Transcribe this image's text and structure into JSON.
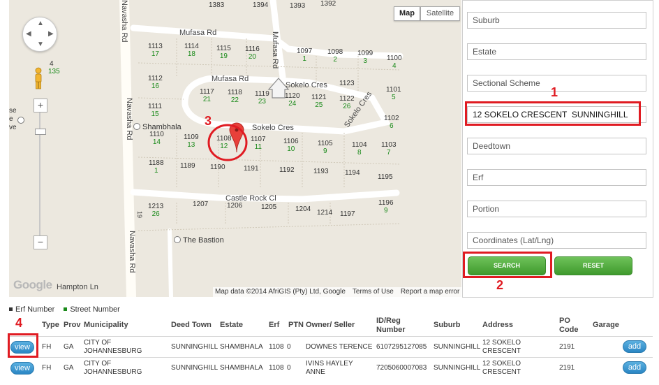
{
  "map": {
    "type_buttons": {
      "map": "Map",
      "satellite": "Satellite"
    },
    "side_numbers": {
      "top": "4",
      "bottom": "135"
    },
    "side_poi": [
      "se",
      "e",
      "ve"
    ],
    "road_labels": {
      "mufasa_top": "Mufasa Rd",
      "mufasa_mid": "Mufasa Rd",
      "mufasa_vertical": "Mufasa Rd",
      "sokelo_cres_top": "Sokelo Cres",
      "sokelo_cres_mid": "Sokelo Cres",
      "sokelo_cres_right": "Sokelo Cres",
      "castle_rock": "Castle Rock Cl",
      "navasha_top": "Navasha Rd",
      "navasha_mid": "Navasha Rd",
      "navasha_bottom": "Navasha Rd",
      "hampton": "Hampton Ln",
      "num_19": "19"
    },
    "poi": {
      "shambhala": "Shambhala",
      "the_bastion": "The Bastion"
    },
    "plots": [
      {
        "erf": "1383",
        "street": ""
      },
      {
        "erf": "1394",
        "street": ""
      },
      {
        "erf": "1393",
        "street": ""
      },
      {
        "erf": "1392",
        "street": ""
      },
      {
        "erf": "1113",
        "street": "17"
      },
      {
        "erf": "1114",
        "street": "18"
      },
      {
        "erf": "1115",
        "street": "19"
      },
      {
        "erf": "1116",
        "street": "20"
      },
      {
        "erf": "1097",
        "street": "1"
      },
      {
        "erf": "1098",
        "street": "2"
      },
      {
        "erf": "1099",
        "street": "3"
      },
      {
        "erf": "1100",
        "street": "4"
      },
      {
        "erf": "1112",
        "street": "16"
      },
      {
        "erf": "1117",
        "street": "21"
      },
      {
        "erf": "1118",
        "street": "22"
      },
      {
        "erf": "1119",
        "street": "23"
      },
      {
        "erf": "1120",
        "street": "24"
      },
      {
        "erf": "1121",
        "street": "25"
      },
      {
        "erf": "1122",
        "street": "26"
      },
      {
        "erf": "1123",
        "street": ""
      },
      {
        "erf": "1101",
        "street": "5"
      },
      {
        "erf": "1111",
        "street": "15"
      },
      {
        "erf": "1102",
        "street": "6"
      },
      {
        "erf": "1110",
        "street": "14"
      },
      {
        "erf": "1109",
        "street": "13"
      },
      {
        "erf": "1108",
        "street": "12"
      },
      {
        "erf": "1107",
        "street": "11"
      },
      {
        "erf": "1106",
        "street": "10"
      },
      {
        "erf": "1105",
        "street": "9"
      },
      {
        "erf": "1104",
        "street": "8"
      },
      {
        "erf": "1103",
        "street": "7"
      },
      {
        "erf": "1188",
        "street": "1"
      },
      {
        "erf": "1189",
        "street": ""
      },
      {
        "erf": "1190",
        "street": ""
      },
      {
        "erf": "1191",
        "street": ""
      },
      {
        "erf": "1192",
        "street": ""
      },
      {
        "erf": "1193",
        "street": ""
      },
      {
        "erf": "1194",
        "street": ""
      },
      {
        "erf": "1195",
        "street": ""
      },
      {
        "erf": "1213",
        "street": "26"
      },
      {
        "erf": "1207",
        "street": ""
      },
      {
        "erf": "1206",
        "street": ""
      },
      {
        "erf": "1205",
        "street": ""
      },
      {
        "erf": "1204",
        "street": ""
      },
      {
        "erf": "1214",
        "street": ""
      },
      {
        "erf": "1197",
        "street": ""
      },
      {
        "erf": "1196",
        "street": "9"
      }
    ],
    "attribution": {
      "data": "Map data ©2014 AfriGIS (Pty) Ltd, Google",
      "terms": "Terms of Use",
      "report": "Report a map error"
    },
    "google_logo": "Google",
    "colors": {
      "marker": "#e8403a",
      "street_number": "#1a8a1a",
      "background": "#ece8df"
    }
  },
  "search": {
    "suburb": {
      "placeholder": "Suburb",
      "value": ""
    },
    "estate": {
      "placeholder": "Estate",
      "value": ""
    },
    "sectional_scheme": {
      "placeholder": "Sectional Scheme",
      "value": ""
    },
    "address": {
      "placeholder": "",
      "value": "12 SOKELO CRESCENT  SUNNINGHILL"
    },
    "deedtown": {
      "placeholder": "Deedtown",
      "value": ""
    },
    "erf": {
      "placeholder": "Erf",
      "value": ""
    },
    "portion": {
      "placeholder": "Portion",
      "value": ""
    },
    "coordinates": {
      "placeholder": "Coordinates (Lat/Lng)",
      "value": ""
    },
    "search_label": "SEARCH",
    "reset_label": "RESET"
  },
  "legend": {
    "erf": "Erf Number",
    "street": "Street Number"
  },
  "annotations": [
    "1",
    "2",
    "3",
    "4"
  ],
  "table": {
    "headers": {
      "type": "Type",
      "prov": "Prov",
      "municipality": "Municipality",
      "deed_town": "Deed Town",
      "estate": "Estate",
      "erf": "Erf",
      "ptn": "PTN",
      "owner": "Owner/ Seller",
      "id_reg": "ID/Reg Number",
      "suburb": "Suburb",
      "address": "Address",
      "po_code": "PO Code",
      "garage": "Garage"
    },
    "rows": [
      {
        "view": "view",
        "type": "FH",
        "prov": "GA",
        "municipality": "CITY OF JOHANNESBURG",
        "deed_town": "SUNNINGHILL",
        "estate": "SHAMBHALA",
        "erf": "1108",
        "ptn": "0",
        "owner": "DOWNES TERENCE",
        "id_reg": "6107295127085",
        "suburb": "SUNNINGHILL",
        "address": "12 SOKELO CRESCENT",
        "po_code": "2191",
        "add": "add"
      },
      {
        "view": "view",
        "type": "FH",
        "prov": "GA",
        "municipality": "CITY OF JOHANNESBURG",
        "deed_town": "SUNNINGHILL",
        "estate": "SHAMBHALA",
        "erf": "1108",
        "ptn": "0",
        "owner": "IVINS HAYLEY ANNE",
        "id_reg": "7205060007083",
        "suburb": "SUNNINGHILL",
        "address": "12 SOKELO CRESCENT",
        "po_code": "2191",
        "add": "add"
      }
    ]
  }
}
